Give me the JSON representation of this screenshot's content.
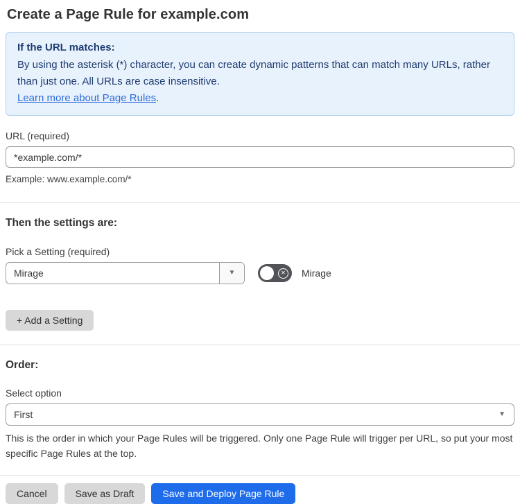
{
  "page": {
    "title": "Create a Page Rule for example.com"
  },
  "info_box": {
    "heading": "If the URL matches:",
    "body": "By using the asterisk (*) character, you can create dynamic patterns that can match many URLs, rather than just one. All URLs are case insensitive.",
    "link_text": "Learn more about Page Rules",
    "link_suffix": "."
  },
  "url_field": {
    "label": "URL (required)",
    "value": "*example.com/*",
    "example": "Example: www.example.com/*"
  },
  "settings_section": {
    "heading": "Then the settings are:",
    "picker_label": "Pick a Setting (required)",
    "picker_value": "Mirage",
    "toggle_label": "Mirage",
    "toggle_state": "off",
    "add_button_label": "+ Add a Setting"
  },
  "order_section": {
    "heading": "Order:",
    "select_label": "Select option",
    "select_value": "First",
    "help_text": "This is the order in which your Page Rules will be triggered. Only one Page Rule will trigger per URL, so put your most specific Page Rules at the top."
  },
  "footer": {
    "cancel_label": "Cancel",
    "save_draft_label": "Save as Draft",
    "save_deploy_label": "Save and Deploy Page Rule"
  },
  "icons": {
    "dropdown_caret_glyph": "▼",
    "toggle_x_glyph": "✕"
  },
  "colors": {
    "info_background": "#e8f2fc",
    "info_border": "#afcfef",
    "info_text": "#1e3b70",
    "link_blue": "#2d6bda",
    "primary_button_blue": "#1f6ceb",
    "gray_button": "#d8d8d8",
    "toggle_off_gray": "#515358",
    "input_border": "#9b9b9b"
  }
}
